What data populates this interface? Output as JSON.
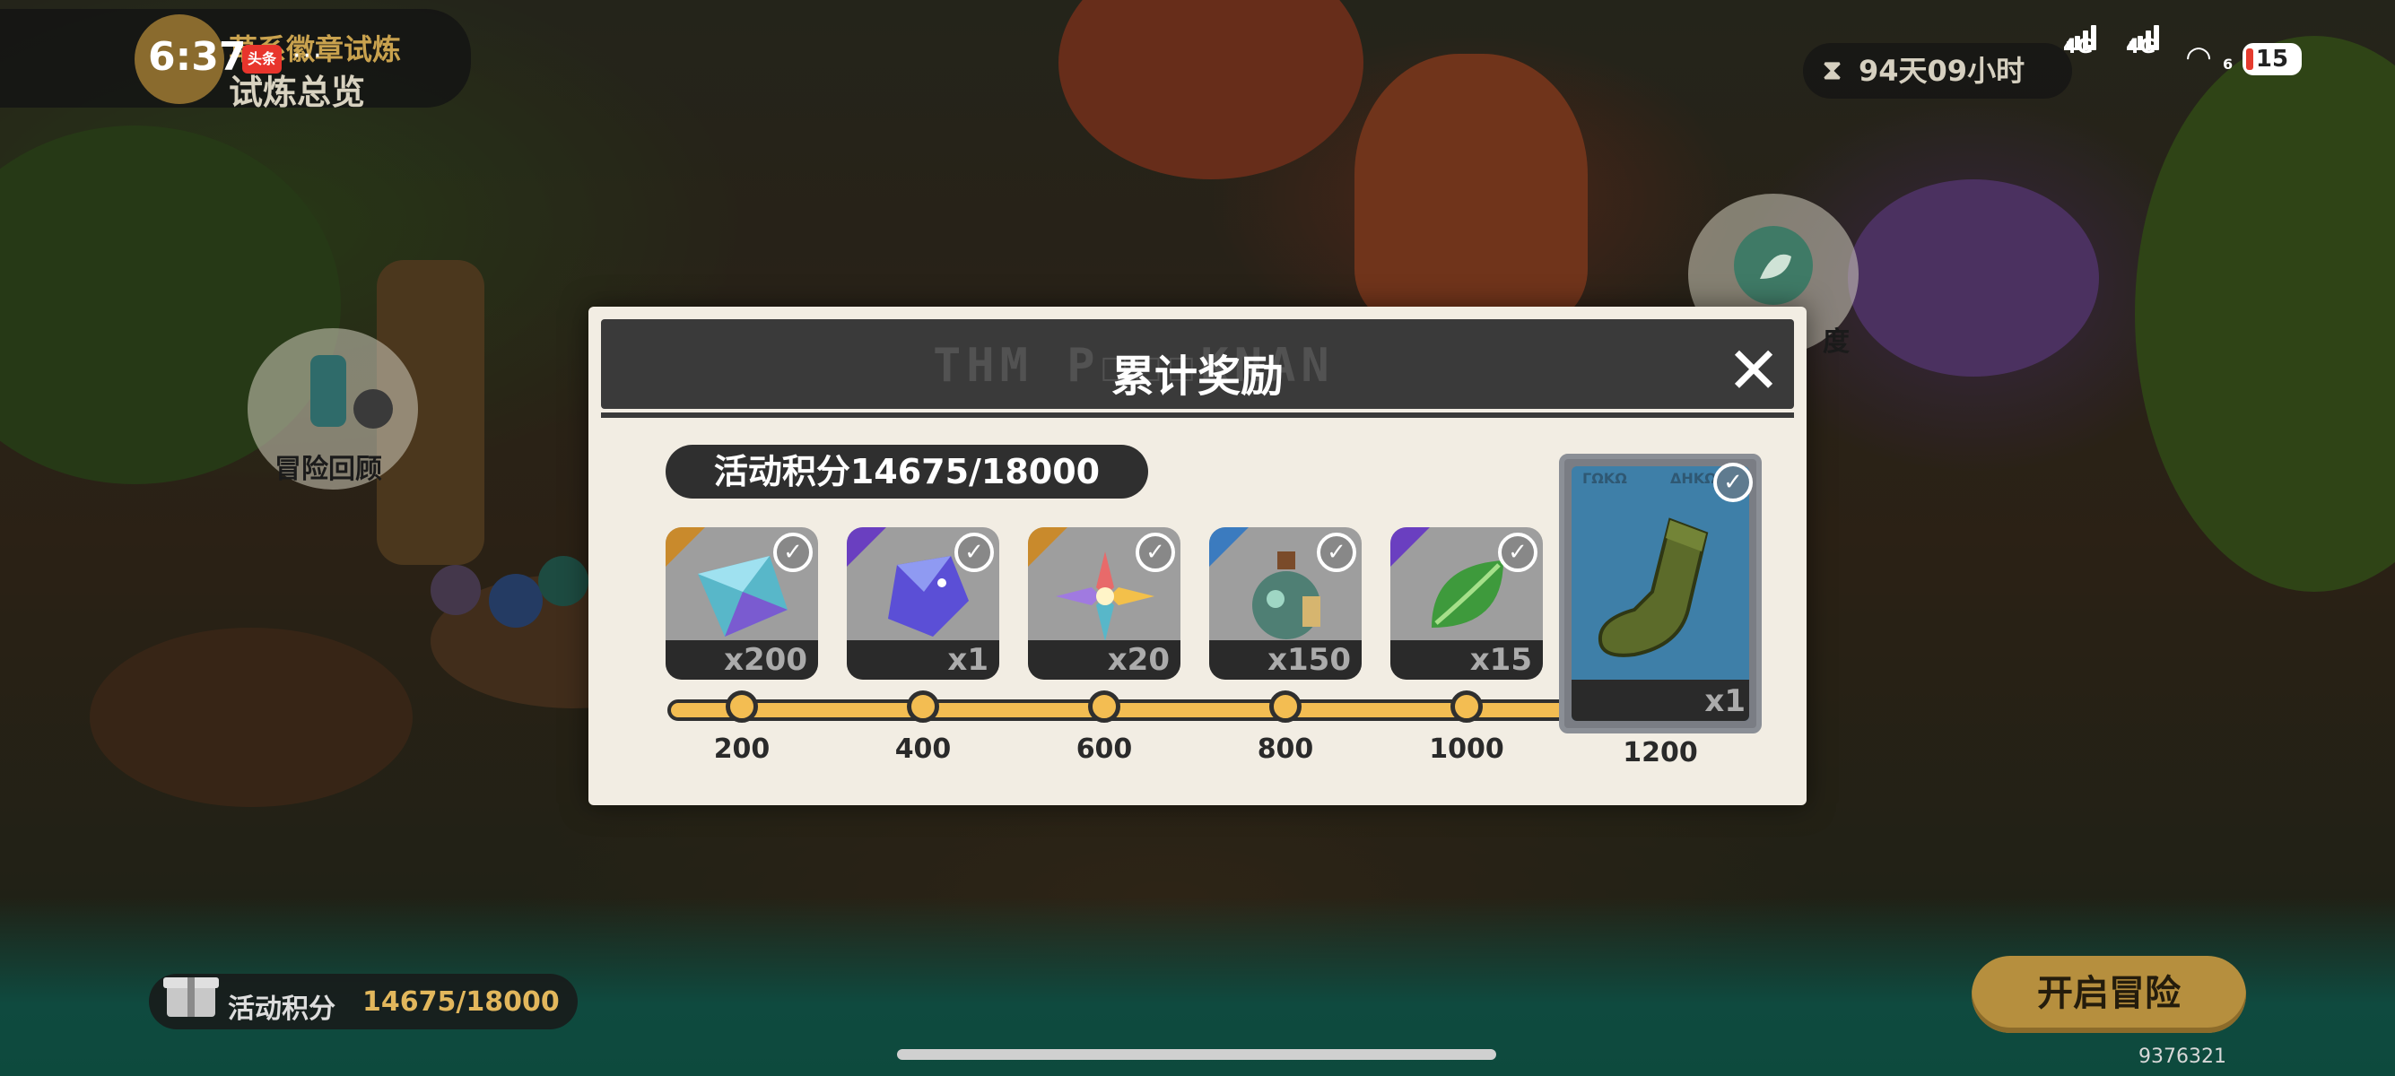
{
  "status_bar": {
    "time": "6:37",
    "news_chip": "头条",
    "more": "···",
    "network_1": "4G",
    "network_2": "4G",
    "wifi_num": "6",
    "battery": "15"
  },
  "event_badge": {
    "subtitle": "草系徽章试炼",
    "title": "试炼总览"
  },
  "timer": {
    "text": "94天09小时"
  },
  "side_left": {
    "label": "冒险回顾"
  },
  "side_right": {
    "label": "度"
  },
  "modal": {
    "title": "累计奖励",
    "close": "✕",
    "points_label": "活动积分14675/18000",
    "rewards": [
      {
        "qty": "x200",
        "milestone": "200",
        "corner_color": "#c98a2c",
        "icon": "prism-crystal-icon"
      },
      {
        "qty": "x1",
        "milestone": "400",
        "corner_color": "#6a3fc0",
        "icon": "blue-gem-icon"
      },
      {
        "qty": "x20",
        "milestone": "600",
        "corner_color": "#c98a2c",
        "icon": "rainbow-flower-icon"
      },
      {
        "qty": "x150",
        "milestone": "800",
        "corner_color": "#3b7bbf",
        "icon": "potion-bottle-icon"
      },
      {
        "qty": "x15",
        "milestone": "1000",
        "corner_color": "#6a3fc0",
        "icon": "green-leaf-icon"
      }
    ],
    "big_reward": {
      "qty": "x1",
      "milestone": "1200",
      "icon": "green-sock-icon",
      "tag_left": "ΓΩΚΩ",
      "tag_right": "ΔΗΚΩ"
    }
  },
  "bottom": {
    "points_label": "活动积分",
    "points_value": "14675/18000",
    "start_button": "开启冒险",
    "build_id": "9376321"
  }
}
